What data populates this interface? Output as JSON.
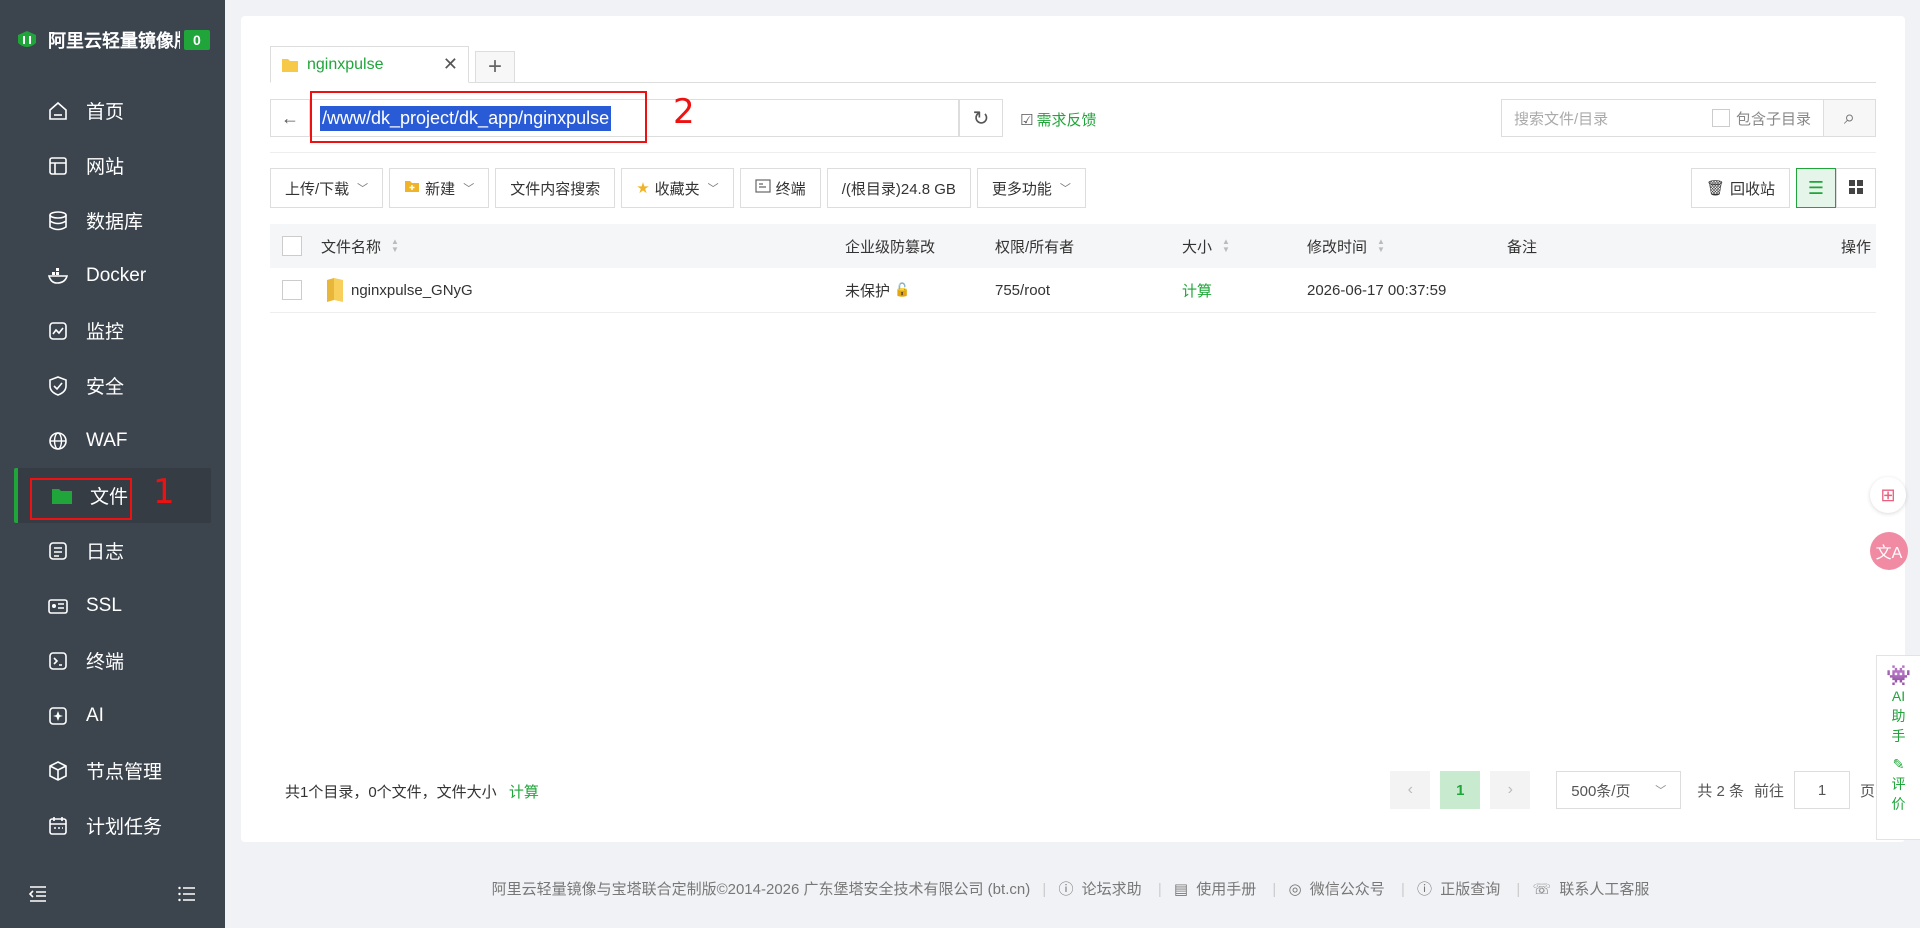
{
  "brand": {
    "name": "阿里云轻量镜像版",
    "count": "0"
  },
  "sidebar": {
    "items": [
      {
        "label": "首页",
        "icon": "home-icon"
      },
      {
        "label": "网站",
        "icon": "website-icon"
      },
      {
        "label": "数据库",
        "icon": "database-icon"
      },
      {
        "label": "Docker",
        "icon": "docker-icon"
      },
      {
        "label": "监控",
        "icon": "monitor-icon"
      },
      {
        "label": "安全",
        "icon": "shield-icon"
      },
      {
        "label": "WAF",
        "icon": "globe-icon"
      },
      {
        "label": "文件",
        "icon": "folder-icon"
      },
      {
        "label": "日志",
        "icon": "log-icon"
      },
      {
        "label": "SSL",
        "icon": "ssl-icon"
      },
      {
        "label": "终端",
        "icon": "terminal-icon"
      },
      {
        "label": "AI",
        "icon": "ai-icon"
      },
      {
        "label": "节点管理",
        "icon": "node-icon"
      },
      {
        "label": "计划任务",
        "icon": "calendar-icon"
      }
    ],
    "active": "文件"
  },
  "annotations": {
    "mark1": "1",
    "mark2": "2"
  },
  "tabs": [
    {
      "label": "nginxpulse"
    }
  ],
  "path": {
    "value": "/www/dk_project/dk_app/nginxpulse"
  },
  "feedback_label": "需求反馈",
  "search": {
    "placeholder": "搜索文件/目录",
    "include_sub": "包含子目录"
  },
  "toolbar": {
    "upload": "上传/下载",
    "new": "新建",
    "content_search": "文件内容搜索",
    "favorites": "收藏夹",
    "terminal": "终端",
    "disk": "/(根目录)24.8 GB",
    "more": "更多功能",
    "recycle": "回收站"
  },
  "table": {
    "headers": {
      "name": "文件名称",
      "protect": "企业级防篡改",
      "perm": "权限/所有者",
      "size": "大小",
      "mtime": "修改时间",
      "note": "备注",
      "action": "操作"
    },
    "rows": [
      {
        "name": "nginxpulse_GNyG",
        "protect": "未保护",
        "perm": "755/root",
        "size": "计算",
        "mtime": "2026-06-17 00:37:59",
        "note": ""
      }
    ]
  },
  "stats": {
    "text": "共1个目录，0个文件，文件大小",
    "calc": "计算"
  },
  "pager": {
    "current": "1",
    "per_page": "500条/页",
    "total": "共 2 条",
    "goto": "前往",
    "page_input": "1",
    "page_unit": "页"
  },
  "footer": {
    "copyright": "阿里云轻量镜像与宝塔联合定制版©2014-2026 广东堡塔安全技术有限公司 (bt.cn)",
    "links": [
      "论坛求助",
      "使用手册",
      "微信公众号",
      "正版查询",
      "联系人工客服"
    ]
  },
  "ai_panel": {
    "label1": "AI",
    "label2": "助",
    "label3": "手",
    "label4": "评",
    "label5": "价"
  },
  "colors": {
    "accent": "#20a53a",
    "sidebar": "#3c444d",
    "annotation": "#ee1111"
  }
}
